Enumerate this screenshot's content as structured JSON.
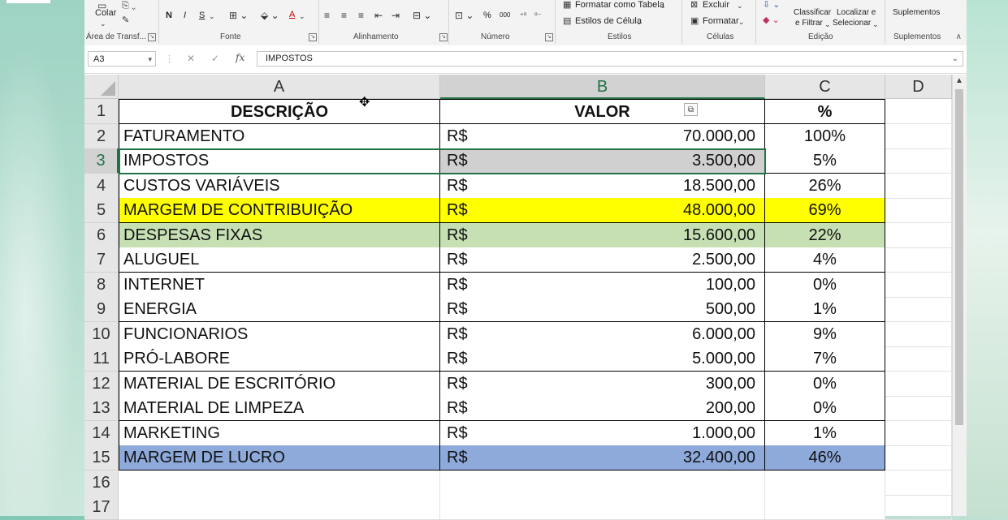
{
  "ribbon": {
    "paste_label": "Colar",
    "groups": {
      "clipboard": "Área de Transf...",
      "font": "Fonte",
      "alignment": "Alinhamento",
      "number": "Número",
      "styles": "Estilos",
      "cells": "Células",
      "editing": "Edição",
      "addins": "Suplementos"
    },
    "font_bold": "N",
    "font_italic": "I",
    "font_underline": "S",
    "font_color_letter": "A",
    "number_percent": "%",
    "number_thousands": "000",
    "format_as_table": "Formatar como Tabela",
    "cell_styles": "Estilos de Célula",
    "delete": "Excluir",
    "format": "Formatar",
    "sort_filter_line1": "Classificar",
    "sort_filter_line2": "e Filtrar",
    "find_select_line1": "Localizar e",
    "find_select_line2": "Selecionar",
    "addins_button": "Suplementos"
  },
  "formula_bar": {
    "name_box": "A3",
    "fx": "fx",
    "content": "IMPOSTOS"
  },
  "columns": [
    "A",
    "B",
    "C",
    "D"
  ],
  "rows": [
    {
      "n": "1",
      "a": "DESCRIÇÃO",
      "cur": "",
      "val": "VALOR",
      "pct": "%",
      "style": "header"
    },
    {
      "n": "2",
      "a": "FATURAMENTO",
      "cur": "R$",
      "val": "70.000,00",
      "pct": "100%",
      "style": "plain"
    },
    {
      "n": "3",
      "a": "IMPOSTOS",
      "cur": "R$",
      "val": "3.500,00",
      "pct": "5%",
      "style": "selected"
    },
    {
      "n": "4",
      "a": "CUSTOS VARIÁVEIS",
      "cur": "R$",
      "val": "18.500,00",
      "pct": "26%",
      "style": "plain"
    },
    {
      "n": "5",
      "a": "MARGEM DE CONTRIBUIÇÃO",
      "cur": "R$",
      "val": "48.000,00",
      "pct": "69%",
      "style": "yellow"
    },
    {
      "n": "6",
      "a": "DESPESAS FIXAS",
      "cur": "R$",
      "val": "15.600,00",
      "pct": "22%",
      "style": "green"
    },
    {
      "n": "7",
      "a": "ALUGUEL",
      "cur": "R$",
      "val": "2.500,00",
      "pct": "4%",
      "style": "plain"
    },
    {
      "n": "8",
      "a": "INTERNET",
      "cur": "R$",
      "val": "100,00",
      "pct": "0%",
      "style": "plain"
    },
    {
      "n": "9",
      "a": "ENERGIA",
      "cur": "R$",
      "val": "500,00",
      "pct": "1%",
      "style": "plain"
    },
    {
      "n": "10",
      "a": "FUNCIONARIOS",
      "cur": "R$",
      "val": "6.000,00",
      "pct": "9%",
      "style": "plain"
    },
    {
      "n": "11",
      "a": "PRÓ-LABORE",
      "cur": "R$",
      "val": "5.000,00",
      "pct": "7%",
      "style": "plain"
    },
    {
      "n": "12",
      "a": "MATERIAL DE ESCRITÓRIO",
      "cur": "R$",
      "val": "300,00",
      "pct": "0%",
      "style": "plain"
    },
    {
      "n": "13",
      "a": "MATERIAL DE LIMPEZA",
      "cur": "R$",
      "val": "200,00",
      "pct": "0%",
      "style": "plain"
    },
    {
      "n": "14",
      "a": "MARKETING",
      "cur": "R$",
      "val": "1.000,00",
      "pct": "1%",
      "style": "plain"
    },
    {
      "n": "15",
      "a": "MARGEM DE LUCRO",
      "cur": "R$",
      "val": "32.400,00",
      "pct": "46%",
      "style": "blue"
    },
    {
      "n": "16",
      "a": "",
      "cur": "",
      "val": "",
      "pct": "",
      "style": "empty"
    },
    {
      "n": "17",
      "a": "",
      "cur": "",
      "val": "",
      "pct": "",
      "style": "empty"
    }
  ],
  "colors": {
    "yellow": "#ffff00",
    "green": "#c6e0b4",
    "blue": "#8eaadb",
    "selected": "#d0d0d0",
    "accent": "#217346"
  },
  "icons": {
    "paste_options": "paste-options-icon",
    "move_cursor": "move-cursor-icon"
  }
}
